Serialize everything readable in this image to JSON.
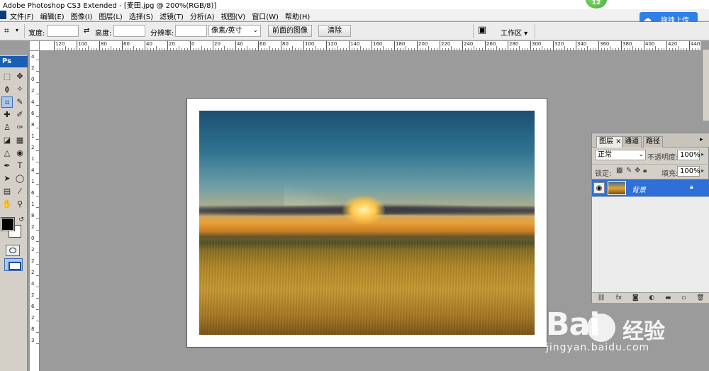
{
  "window": {
    "title": "Adobe Photoshop CS3 Extended - [麦田.jpg @ 200%(RGB/8)]",
    "notification_count": "12"
  },
  "menubar": {
    "items": [
      "文件(F)",
      "编辑(E)",
      "图像(I)",
      "图层(L)",
      "选择(S)",
      "滤镜(T)",
      "分析(A)",
      "视图(V)",
      "窗口(W)",
      "帮助(H)"
    ]
  },
  "upload": {
    "label": "拖拽上传"
  },
  "options": {
    "width_label": "宽度:",
    "width_value": "",
    "swap_icon": "⇄",
    "height_label": "高度:",
    "height_value": "",
    "resolution_label": "分辨率:",
    "resolution_value": "",
    "unit_select": "像素/英寸",
    "front_image_button": "前面的图像",
    "clear_button": "清除",
    "workspace_label": "工作区"
  },
  "ruler": {
    "top_ticks": [
      "120",
      "100",
      "80",
      "60",
      "40",
      "20",
      "0",
      "20",
      "40",
      "60",
      "80",
      "100",
      "120",
      "140",
      "160",
      "180",
      "200",
      "220",
      "240",
      "260",
      "280",
      "300",
      "320",
      "340",
      "360",
      "380",
      "400",
      "420",
      "440"
    ],
    "left_ticks": [
      "4",
      "2",
      "0",
      "2",
      "4",
      "6",
      "8",
      "1",
      "2",
      "1",
      "4",
      "1",
      "6",
      "1",
      "8",
      "2",
      "0",
      "2",
      "2",
      "2",
      "4",
      "2",
      "6",
      "2",
      "8",
      "3"
    ]
  },
  "toolbox": {
    "logo": "Ps",
    "foreground_color": "#000000",
    "background_color": "#ffffff"
  },
  "layers_panel": {
    "tabs": [
      "图层",
      "通道",
      "路径"
    ],
    "blend_mode": "正常",
    "opacity_label": "不透明度:",
    "opacity_value": "100%",
    "lock_label": "锁定:",
    "fill_label": "填充:",
    "fill_value": "100%",
    "layers": [
      {
        "name": "背景",
        "visible": true,
        "locked": true,
        "selected": true
      }
    ]
  },
  "watermark": {
    "brand": "Bai",
    "brand_cn": "经验",
    "url": "jingyan.baidu.com"
  },
  "colors": {
    "accent": "#2e6fd8",
    "upload_button": "#2f7fe8",
    "canvas_bg": "#9b9b9b"
  }
}
